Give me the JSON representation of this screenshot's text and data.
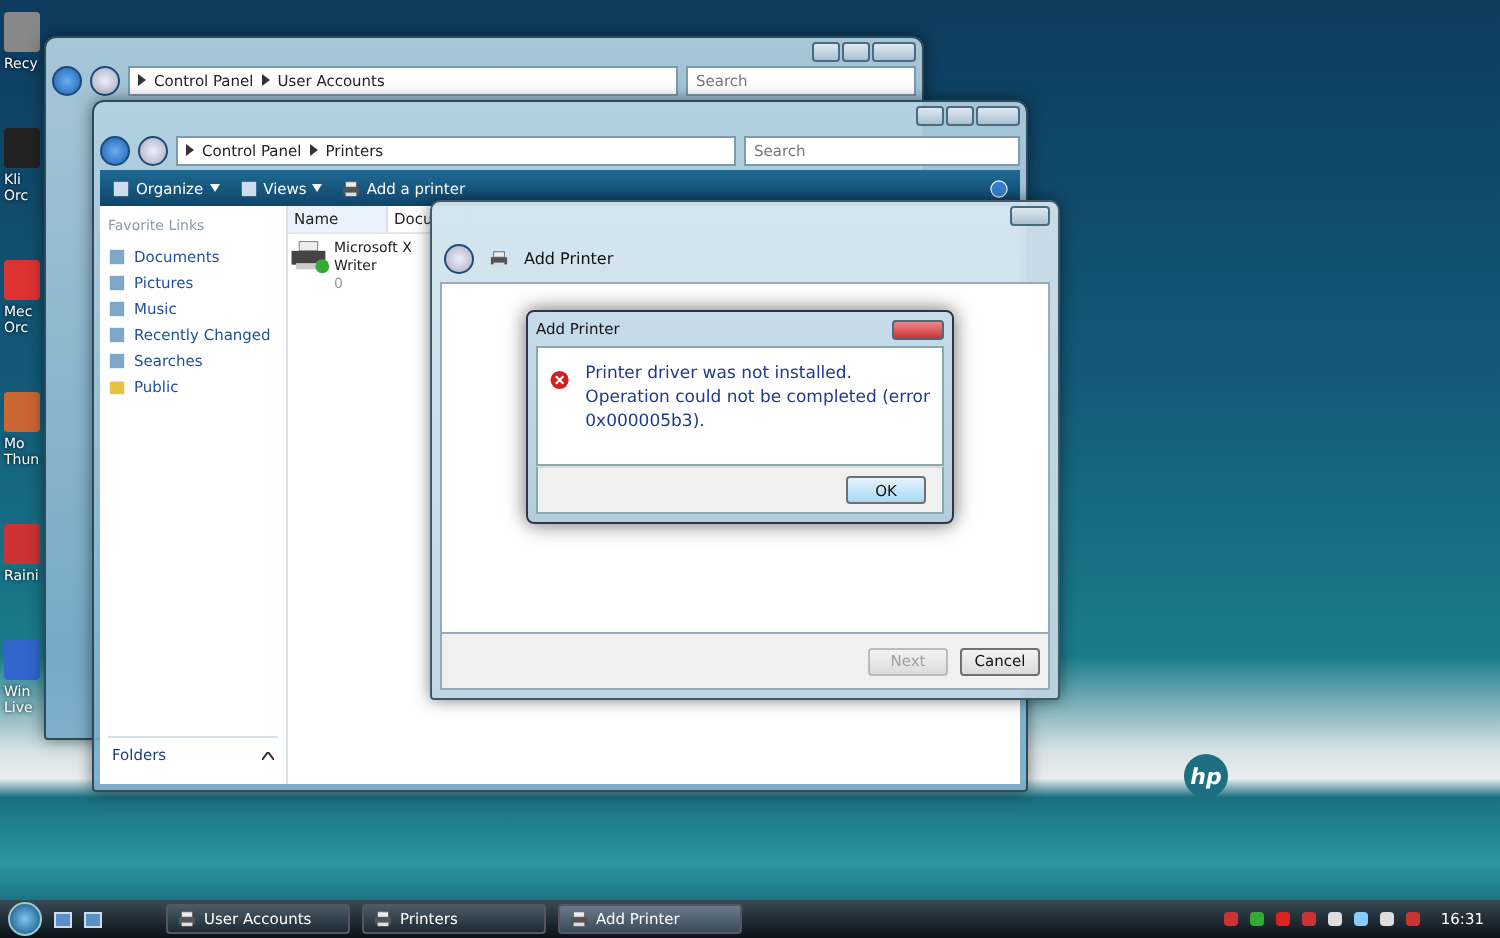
{
  "desktop": {
    "icons": [
      {
        "label": "Recy"
      },
      {
        "label": "Kli Orc"
      },
      {
        "label": "Mec Orc"
      },
      {
        "label": "Mo Thun"
      },
      {
        "label": "Raini"
      },
      {
        "label": "Win Live"
      }
    ],
    "logo": "hp"
  },
  "back_window": {
    "address": [
      "Control Panel",
      "User Accounts"
    ],
    "search": {
      "placeholder": "Search"
    }
  },
  "printers_window": {
    "address": [
      "Control Panel",
      "Printers"
    ],
    "search": {
      "placeholder": "Search"
    },
    "toolbar": [
      {
        "label": "Organize",
        "kind": "menu"
      },
      {
        "label": "Views",
        "kind": "menu"
      },
      {
        "label": "Add a printer",
        "kind": "action"
      }
    ],
    "favorite_links": {
      "title": "Favorite Links",
      "items": [
        {
          "label": "Documents",
          "kind": "library"
        },
        {
          "label": "Pictures",
          "kind": "library"
        },
        {
          "label": "Music",
          "kind": "library"
        },
        {
          "label": "Recently Changed",
          "kind": "library"
        },
        {
          "label": "Searches",
          "kind": "library"
        },
        {
          "label": "Public",
          "kind": "folder"
        }
      ]
    },
    "folders": "Folders",
    "columns": [
      "Name",
      "Docu"
    ],
    "printers": [
      {
        "name_lines": [
          "Microsoft X",
          "Writer"
        ],
        "documents": "0",
        "default": true
      }
    ]
  },
  "wizard": {
    "title": "Add Printer",
    "buttons": [
      {
        "label": "Next",
        "disabled": true
      },
      {
        "label": "Cancel",
        "disabled": false
      }
    ]
  },
  "error_dialog": {
    "title": "Add Printer",
    "message": [
      "Printer driver was not installed.",
      "Operation could not be completed (error",
      "0x000005b3)."
    ],
    "button": "OK"
  },
  "taskbar": {
    "tasks": [
      {
        "label": "User Accounts",
        "selected": false
      },
      {
        "label": "Printers",
        "selected": false
      },
      {
        "label": "Add Printer",
        "selected": true
      }
    ],
    "clock": "16:31"
  }
}
